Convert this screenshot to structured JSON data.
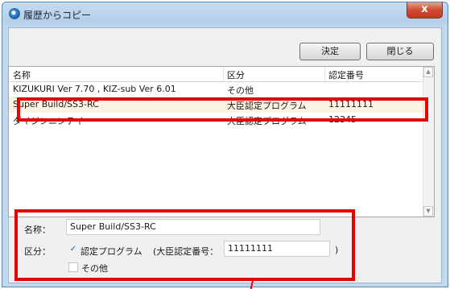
{
  "window": {
    "title": "履歴からコピー",
    "close_glyph": "x"
  },
  "toolbar": {
    "confirm_label": "決定",
    "close_label": "閉じる"
  },
  "list": {
    "columns": [
      "名称",
      "区分",
      "認定番号"
    ],
    "rows": [
      {
        "name": "KIZUKURI Ver 7.70 , KIZ-sub Ver 6.01",
        "category": "その他",
        "number": ""
      },
      {
        "name": "Super Build/SS3-RC",
        "category": "大臣認定プログラム",
        "number": "11111111"
      },
      {
        "name": "ダイジンニンテイ",
        "category": "大臣認定プログラム",
        "number": "12345"
      }
    ],
    "selected_index": 1
  },
  "form": {
    "name_label": "名称：",
    "name_value": "Super Build/SS3-RC",
    "category_label": "区分：",
    "certified_program_label": "認定プログラム",
    "certified_program_checked": true,
    "check_glyph": "✓",
    "minister_number_label": "(大臣認定番号：",
    "minister_number_value": "11111111",
    "close_paren": ")",
    "other_label": "その他",
    "other_checked": false
  },
  "colors": {
    "highlight": "#e60000",
    "selected_row": "#fdf3e2",
    "titlebar": "#c4d8ec"
  }
}
